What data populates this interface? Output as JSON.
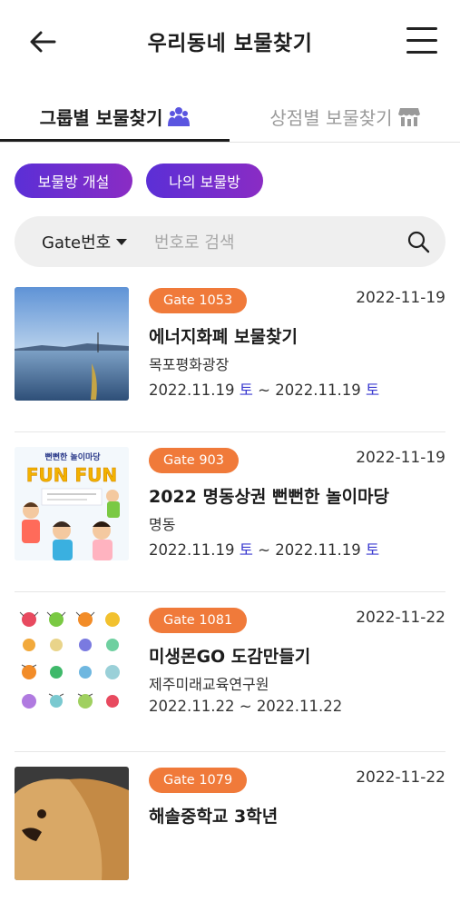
{
  "header": {
    "title": "우리동네 보물찾기"
  },
  "tabs": [
    {
      "label": "그룹별 보물찾기",
      "icon": "group-icon",
      "active": true
    },
    {
      "label": "상점별 보물찾기",
      "icon": "store-icon",
      "active": false
    }
  ],
  "pills": {
    "create": "보물방 개설",
    "mine": "나의 보물방"
  },
  "search": {
    "select_label": "Gate번호",
    "placeholder": "번호로 검색",
    "value": ""
  },
  "items": [
    {
      "gate": "Gate 1053",
      "date": "2022-11-19",
      "title": "에너지화폐 보물찾기",
      "place": "목포평화광장",
      "start": "2022.11.19",
      "start_day": "토",
      "sep": " ~ ",
      "end": "2022.11.19",
      "end_day": "토"
    },
    {
      "gate": "Gate 903",
      "date": "2022-11-19",
      "title": "2022 명동상권 뻔뻔한 놀이마당",
      "place": "명동",
      "start": "2022.11.19",
      "start_day": "토",
      "sep": " ~ ",
      "end": "2022.11.19",
      "end_day": "토",
      "poster_text": {
        "top": "뻔뻔한 놀이마당",
        "big": "FUN FUN"
      }
    },
    {
      "gate": "Gate 1081",
      "date": "2022-11-22",
      "title": "미생몬GO 도감만들기",
      "place": "제주미래교육연구원",
      "start": "2022.11.22",
      "start_day": "",
      "sep": " ~ ",
      "end": "2022.11.22",
      "end_day": ""
    },
    {
      "gate": "Gate 1079",
      "date": "2022-11-22",
      "title": "해솔중학교 3학년",
      "place": "",
      "start": "",
      "start_day": "",
      "sep": "",
      "end": "",
      "end_day": ""
    }
  ],
  "colors": {
    "accent_purple": "#6a2fd0",
    "badge_orange": "#f07a3a",
    "day_blue": "#3b3bd0"
  }
}
